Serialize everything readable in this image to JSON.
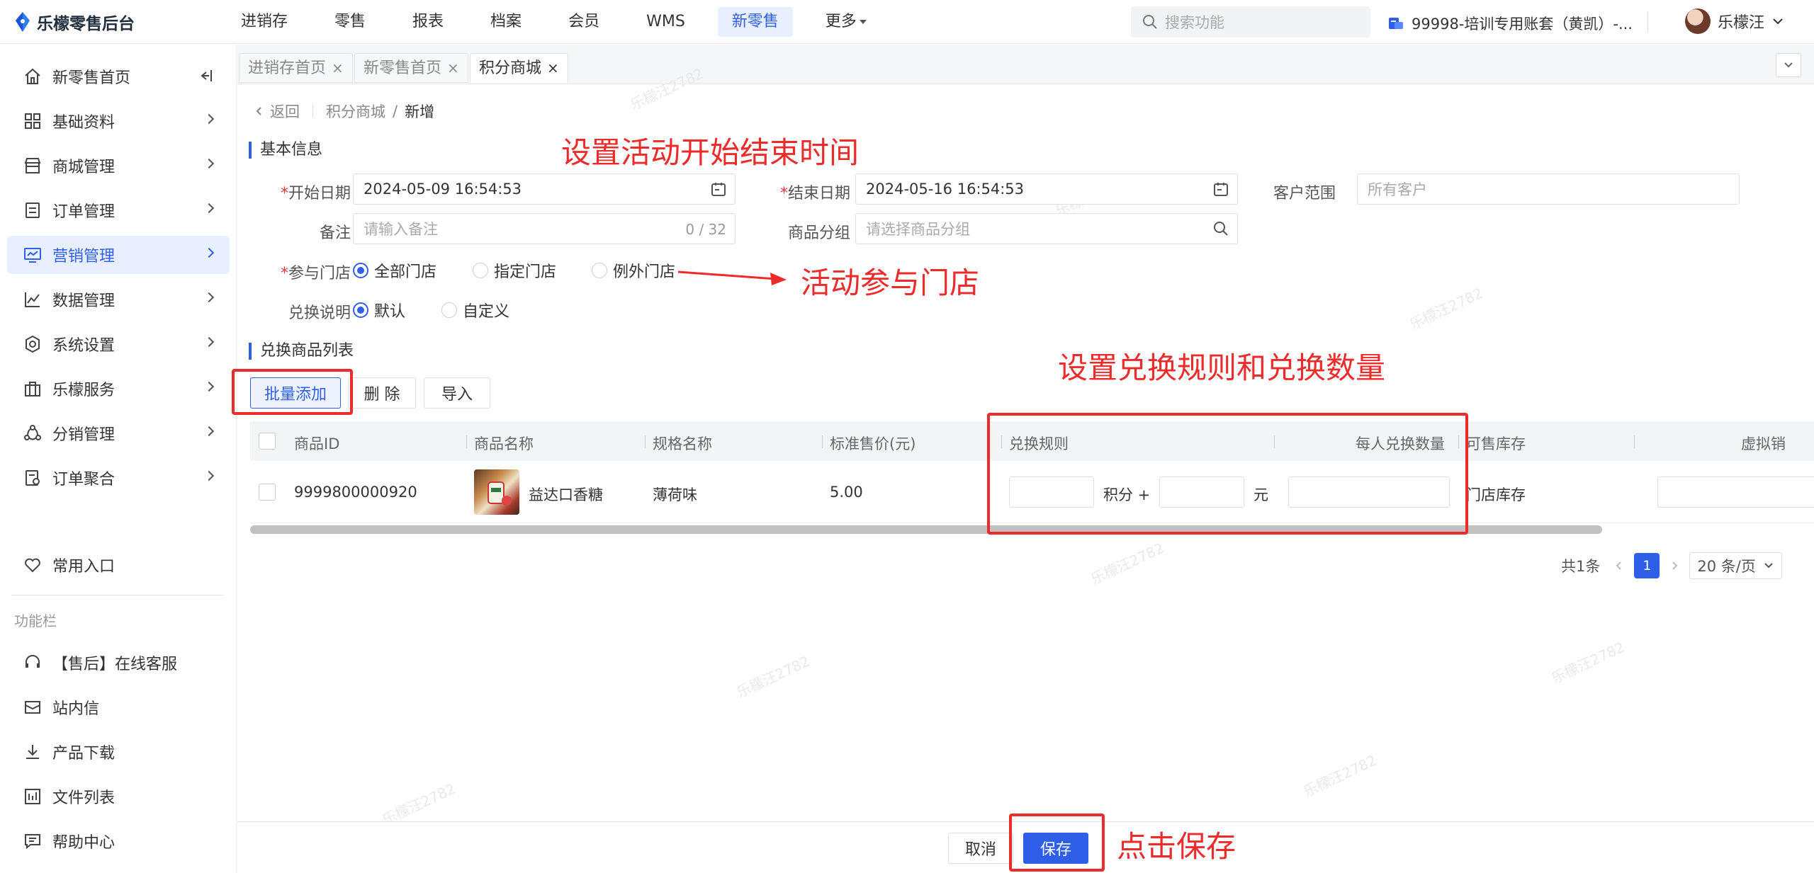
{
  "app": {
    "title": "乐檬零售后台"
  },
  "topnav": {
    "items": [
      "进销存",
      "零售",
      "报表",
      "档案",
      "会员",
      "WMS",
      "新零售",
      "更多"
    ],
    "active": "新零售"
  },
  "search": {
    "placeholder": "搜索功能"
  },
  "account": {
    "label": "99998-培训专用账套（黄凯）-..."
  },
  "user": {
    "name": "乐檬汪"
  },
  "sidebar": {
    "items": [
      {
        "label": "新零售首页",
        "icon": "home-icon"
      },
      {
        "label": "基础资料",
        "icon": "grid-icon"
      },
      {
        "label": "商城管理",
        "icon": "store-icon"
      },
      {
        "label": "订单管理",
        "icon": "order-icon"
      },
      {
        "label": "营销管理",
        "icon": "marketing-icon"
      },
      {
        "label": "数据管理",
        "icon": "chart-line-icon"
      },
      {
        "label": "系统设置",
        "icon": "settings-icon"
      },
      {
        "label": "乐檬服务",
        "icon": "briefcase-icon"
      },
      {
        "label": "分销管理",
        "icon": "distribution-icon"
      },
      {
        "label": "订单聚合",
        "icon": "aggregate-icon"
      }
    ],
    "active_index": 4,
    "favorites": "常用入口",
    "section_title": "功能栏",
    "tools": [
      {
        "label": "【售后】在线客服",
        "icon": "headset-icon"
      },
      {
        "label": "站内信",
        "icon": "mail-icon"
      },
      {
        "label": "产品下载",
        "icon": "download-icon"
      },
      {
        "label": "文件列表",
        "icon": "file-list-icon"
      },
      {
        "label": "帮助中心",
        "icon": "help-icon"
      }
    ]
  },
  "tabs": [
    {
      "label": "进销存首页",
      "close": "×"
    },
    {
      "label": "新零售首页",
      "close": "×"
    },
    {
      "label": "积分商城",
      "close": "×"
    }
  ],
  "breadcrumb": {
    "back": "返回",
    "parent": "积分商城",
    "sep": "/",
    "current": "新增"
  },
  "form": {
    "section_basic": "基本信息",
    "start_label": "开始日期",
    "start_value": "2024-05-09 16:54:53",
    "end_label": "结束日期",
    "end_value": "2024-05-16 16:54:53",
    "customer_label": "客户范围",
    "customer_placeholder": "所有客户",
    "remark_label": "备注",
    "remark_placeholder": "请输入备注",
    "remark_count": "0 / 32",
    "group_label": "商品分组",
    "group_placeholder": "请选择商品分组",
    "store_label": "参与门店",
    "store_options": [
      "全部门店",
      "指定门店",
      "例外门店"
    ],
    "store_selected": 0,
    "desc_label": "兑换说明",
    "desc_options": [
      "默认",
      "自定义"
    ],
    "desc_selected": 0,
    "required_mark": "*"
  },
  "list": {
    "section_title": "兑换商品列表",
    "batch_add": "批量添加",
    "delete": "删 除",
    "import": "导入",
    "columns": [
      "商品ID",
      "商品名称",
      "规格名称",
      "标准售价(元)",
      "兑换规则",
      "每人兑换数量",
      "可售库存",
      "虚拟销"
    ],
    "rows": [
      {
        "id": "9999800000920",
        "name": "益达口香糖",
        "spec": "薄荷味",
        "price": "5.00",
        "points_unit": "积分 +",
        "yuan_unit": "元",
        "stock": "门店库存"
      }
    ],
    "total": "共1条",
    "page": "1",
    "page_size": "20 条/页"
  },
  "footer": {
    "cancel": "取消",
    "save": "保存"
  },
  "annotations": {
    "time": "设置活动开始结束时间",
    "store": "活动参与门店",
    "rule": "设置兑换规则和兑换数量",
    "save": "点击保存"
  },
  "colors": {
    "primary": "#2f5fe8",
    "annotation": "#ee2b2b",
    "required": "#e53935"
  }
}
